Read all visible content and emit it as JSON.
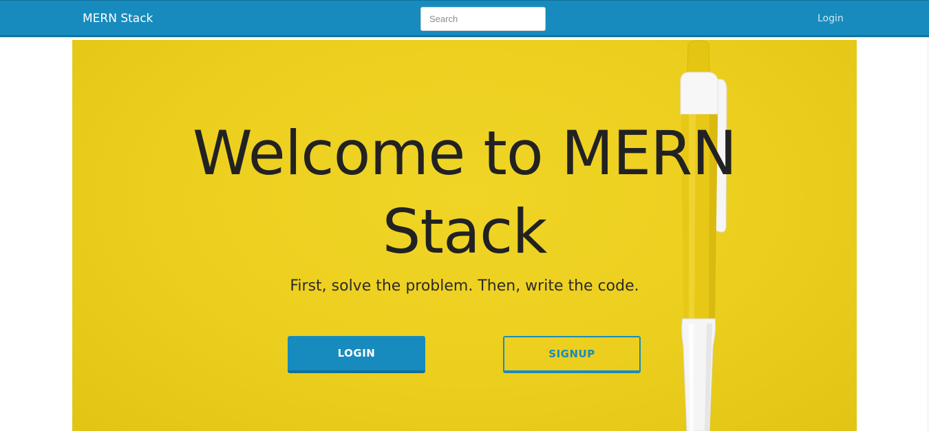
{
  "navbar": {
    "brand": "MERN Stack",
    "search_placeholder": "Search",
    "login_link": "Login"
  },
  "hero": {
    "title_line1": "Welcome to MERN",
    "title_line2": "Stack",
    "subtitle": "First, solve the problem. Then, write the code.",
    "login_button": "LOGIN",
    "signup_button": "SIGNUP"
  },
  "colors": {
    "primary": "#178bbd",
    "hero_background": "#ecce1e",
    "text_dark": "#222222"
  }
}
